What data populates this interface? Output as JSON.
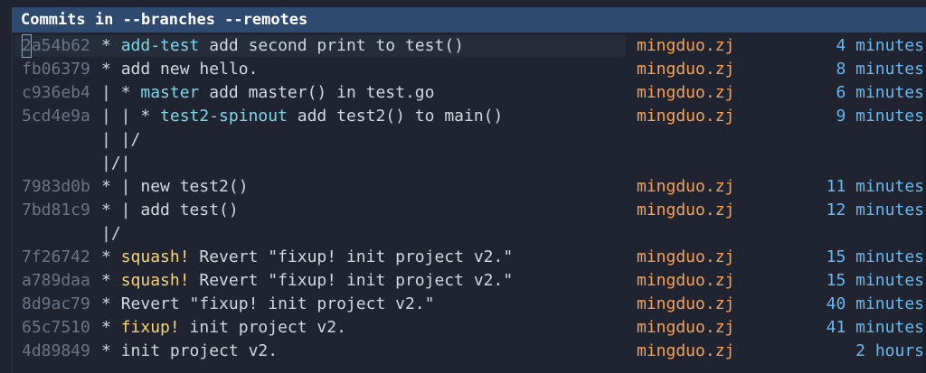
{
  "header": {
    "title": "Commits in --branches --remotes"
  },
  "rows": [
    {
      "hash": "2a54b62",
      "graph": "* ",
      "refs": "add-test",
      "ref_style": "branch",
      "message": " add second print to test()",
      "author": "mingduo.zj",
      "time": "4 minutes"
    },
    {
      "hash": "fb06379",
      "graph": "* ",
      "refs": "",
      "ref_style": "",
      "message": "add new hello.",
      "author": "mingduo.zj",
      "time": "8 minutes"
    },
    {
      "hash": "c936eb4",
      "graph": "| * ",
      "refs": "master",
      "ref_style": "branch",
      "message": " add master() in test.go",
      "author": "mingduo.zj",
      "time": "6 minutes"
    },
    {
      "hash": "5cd4e9a",
      "graph": "| | * ",
      "refs": "test2-spinout",
      "ref_style": "branch",
      "message": " add test2() to main()",
      "author": "mingduo.zj",
      "time": "9 minutes"
    },
    {
      "hash": "",
      "graph": "| |/",
      "refs": "",
      "ref_style": "",
      "message": "",
      "author": "",
      "time": ""
    },
    {
      "hash": "",
      "graph": "|/|",
      "refs": "",
      "ref_style": "",
      "message": "",
      "author": "",
      "time": ""
    },
    {
      "hash": "7983d0b",
      "graph": "* | ",
      "refs": "",
      "ref_style": "",
      "message": "new test2()",
      "author": "mingduo.zj",
      "time": "11 minutes"
    },
    {
      "hash": "7bd81c9",
      "graph": "* | ",
      "refs": "",
      "ref_style": "",
      "message": "add test()",
      "author": "mingduo.zj",
      "time": "12 minutes"
    },
    {
      "hash": "",
      "graph": "|/",
      "refs": "",
      "ref_style": "",
      "message": "",
      "author": "",
      "time": ""
    },
    {
      "hash": "7f26742",
      "graph": "* ",
      "refs": "squash!",
      "ref_style": "yellow",
      "message": " Revert \"fixup! init project v2.\"",
      "author": "mingduo.zj",
      "time": "15 minutes"
    },
    {
      "hash": "a789daa",
      "graph": "* ",
      "refs": "squash!",
      "ref_style": "yellow",
      "message": " Revert \"fixup! init project v2.\"",
      "author": "mingduo.zj",
      "time": "15 minutes"
    },
    {
      "hash": "8d9ac79",
      "graph": "* ",
      "refs": "",
      "ref_style": "",
      "message": "Revert \"fixup! init project v2.\"",
      "author": "mingduo.zj",
      "time": "40 minutes"
    },
    {
      "hash": "65c7510",
      "graph": "* ",
      "refs": "fixup!",
      "ref_style": "yellow",
      "message": " init project v2.",
      "author": "mingduo.zj",
      "time": "41 minutes"
    },
    {
      "hash": "4d89849",
      "graph": "* ",
      "refs": "",
      "ref_style": "",
      "message": "init project v2.",
      "author": "mingduo.zj",
      "time": "2 hours"
    }
  ],
  "colors": {
    "header_bg": "#2e4a6f",
    "hash": "#6c7586",
    "branch": "#7fd6e8",
    "keyword": "#f5d37a",
    "author": "#f5a25d",
    "time": "#6bb8f0"
  }
}
